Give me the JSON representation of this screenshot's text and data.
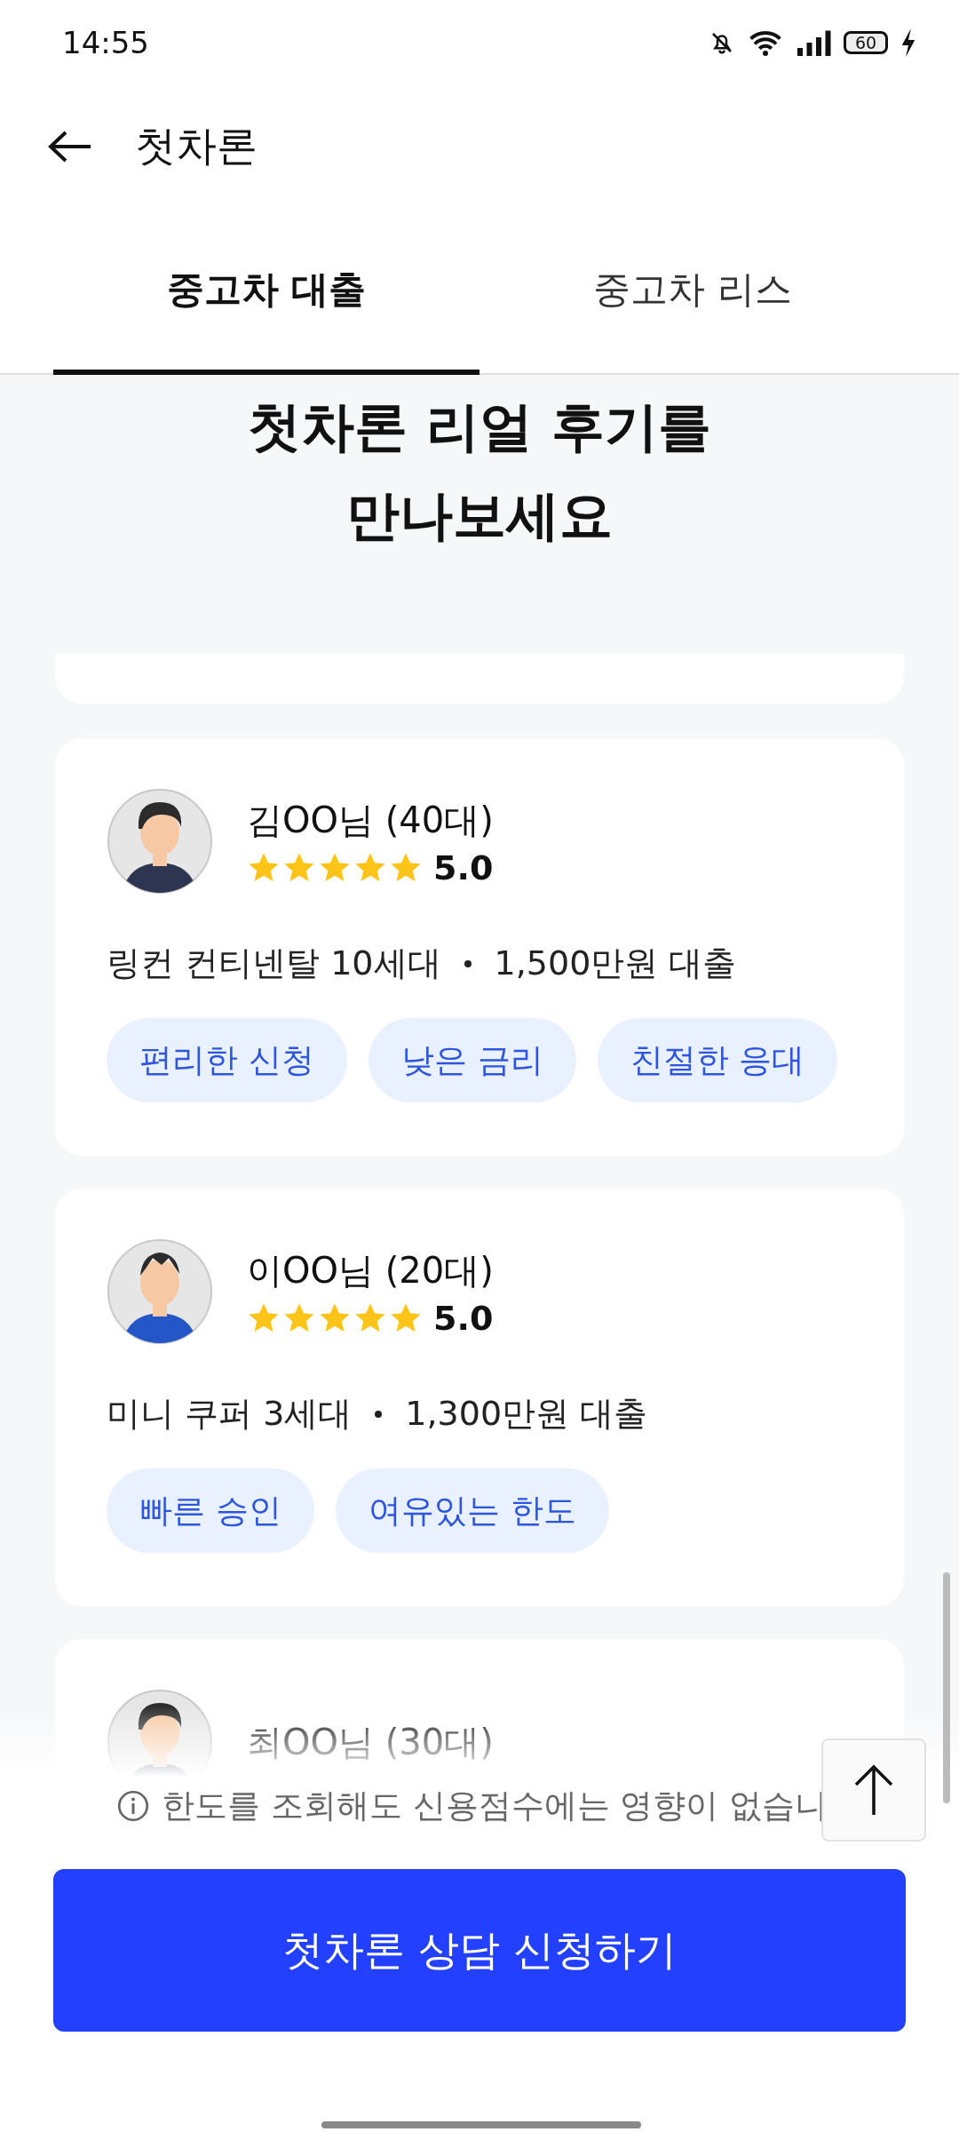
{
  "status_bar": {
    "time": "14:55",
    "battery": "60"
  },
  "app_bar": {
    "title": "첫차론"
  },
  "tabs": [
    {
      "label": "중고차 대출",
      "selected": true
    },
    {
      "label": "중고차 리스",
      "selected": false
    }
  ],
  "heading": [
    "첫차론 리얼 후기를",
    "만나보세요"
  ],
  "reviews": [
    {
      "name": "김OO님 (40대)",
      "stars": 5,
      "rating": "5.0",
      "car": "링컨 컨티넨탈 10세대",
      "amount": "1,500만원 대출",
      "tags": [
        "편리한 신청",
        "낮은 금리",
        "친절한 응대"
      ]
    },
    {
      "name": "이OO님 (20대)",
      "stars": 5,
      "rating": "5.0",
      "car": "미니 쿠퍼 3세대",
      "amount": "1,300만원 대출",
      "tags": [
        "빠른 승인",
        "여유있는 한도"
      ]
    },
    {
      "name": "최OO님 (30대)"
    }
  ],
  "notice": "한도를 조회해도 신용점수에는 영향이 없습니",
  "cta": "첫차론 상담 신청하기"
}
